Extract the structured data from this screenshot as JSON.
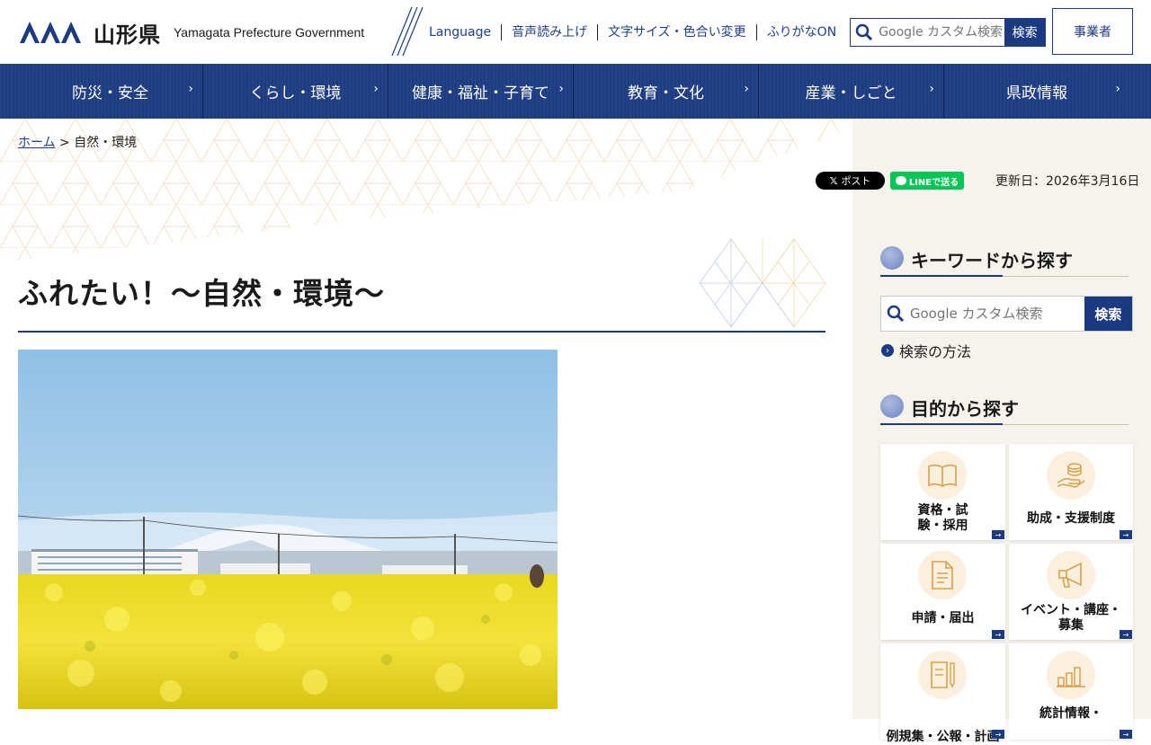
{
  "header": {
    "logo_ja": "山形県",
    "logo_en": "Yamagata Prefecture Government",
    "util_links": [
      "Language",
      "音声読み上げ",
      "文字サイズ・色合い変更",
      "ふりがなON"
    ],
    "search_placeholder": "Google カスタム検索",
    "search_button": "検索",
    "business_button": "事業者"
  },
  "nav": [
    "防災・安全",
    "くらし・環境",
    "健康・福祉・子育て",
    "教育・文化",
    "産業・しごと",
    "県政情報"
  ],
  "breadcrumb": {
    "home": "ホーム",
    "separator": ">",
    "current": "自然・環境"
  },
  "share": {
    "x_label": "ポスト",
    "line_label": "LINEで送る"
  },
  "updated": "更新日：2026年3月16日",
  "page_title": "ふれたい！～自然・環境～",
  "sidebar": {
    "keyword_heading": "キーワードから探す",
    "search_placeholder": "Google カスタム検索",
    "search_button": "検索",
    "howto_link": "検索の方法",
    "purpose_heading": "目的から探す",
    "tiles": [
      {
        "label": "資格・試験・採用",
        "icon": "book-icon"
      },
      {
        "label": "助成・支援制度",
        "icon": "coin-hand-icon"
      },
      {
        "label": "申請・届出",
        "icon": "document-icon"
      },
      {
        "label": "イベント・講座・募集",
        "icon": "megaphone-icon"
      },
      {
        "label": "例規集・公報・計画",
        "icon": "pen-paper-icon"
      },
      {
        "label": "統計情報・",
        "icon": "bar-chart-icon"
      }
    ]
  },
  "colors": {
    "primary": "#1b3a82",
    "nav_bg": "#1d3b80",
    "sidebar_bg": "#f6f3ec",
    "tile_circle": "#fbf0de"
  }
}
